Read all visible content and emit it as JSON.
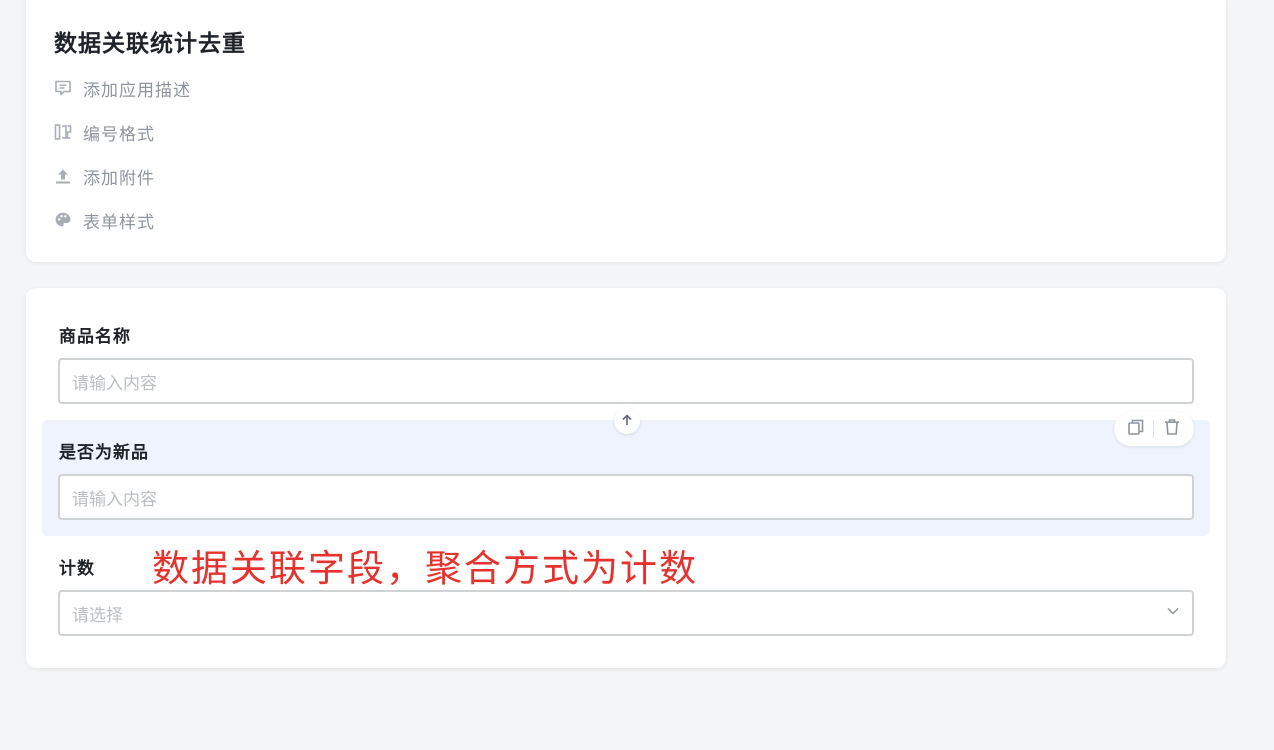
{
  "app": {
    "title": "数据关联统计去重"
  },
  "actions": {
    "add_description": {
      "label": "添加应用描述",
      "icon": "comment-icon"
    },
    "number_format": {
      "label": "编号格式",
      "icon": "number-format-icon"
    },
    "add_attachment": {
      "label": "添加附件",
      "icon": "upload-icon"
    },
    "form_style": {
      "label": "表单样式",
      "icon": "palette-icon"
    }
  },
  "form": {
    "fields": [
      {
        "label": "商品名称",
        "placeholder": "请输入内容",
        "type": "text"
      },
      {
        "label": "是否为新品",
        "placeholder": "请输入内容",
        "type": "text",
        "selected": true
      },
      {
        "label": "计数",
        "placeholder": "请选择",
        "type": "select"
      }
    ]
  },
  "annotation": {
    "text": "数据关联字段，聚合方式为计数",
    "color": "#e5322d"
  },
  "colors": {
    "background": "#f4f5f7",
    "card": "#ffffff",
    "selected_block": "#eef3fd",
    "muted_text": "#8f959e",
    "placeholder": "#bbbfc4"
  }
}
